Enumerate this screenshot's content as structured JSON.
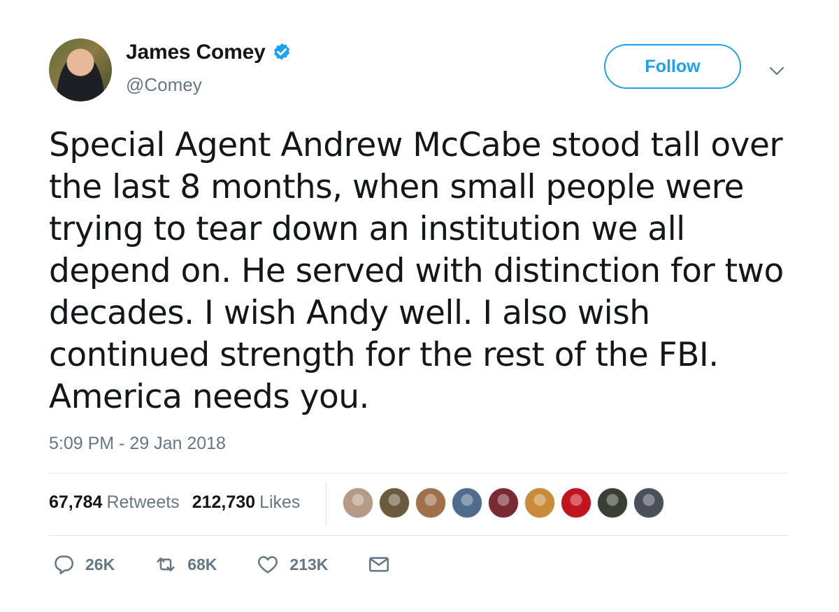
{
  "user": {
    "name": "James Comey",
    "handle": "@Comey"
  },
  "follow_label": "Follow",
  "tweet": {
    "lines": [
      "Special Agent Andrew McCabe stood tall over",
      "the last 8 months, when small people were",
      "trying to tear down an institution we all",
      "depend on. He served with distinction for two",
      "decades. I wish Andy well. I also wish",
      "continued strength for the rest of the FBI.",
      "America needs you."
    ]
  },
  "timestamp": "5:09 PM - 29 Jan 2018",
  "stats": {
    "retweets_count": "67,784",
    "retweets_label": "Retweets",
    "likes_count": "212,730",
    "likes_label": "Likes"
  },
  "likers": [
    {
      "icon": "liker-avatar",
      "color": "#b79a86"
    },
    {
      "icon": "liker-avatar",
      "color": "#6b5a3e"
    },
    {
      "icon": "liker-avatar",
      "color": "#a0704a"
    },
    {
      "icon": "liker-avatar",
      "color": "#4f6c8c"
    },
    {
      "icon": "liker-avatar",
      "color": "#7a2a33"
    },
    {
      "icon": "liker-avatar",
      "color": "#c98a3a"
    },
    {
      "icon": "liker-avatar",
      "color": "#c0141e"
    },
    {
      "icon": "liker-avatar",
      "color": "#3a3f33"
    },
    {
      "icon": "liker-avatar",
      "color": "#4a4f5a"
    }
  ],
  "actions": {
    "reply_count": "26K",
    "retweet_count": "68K",
    "like_count": "213K"
  },
  "colors": {
    "accent": "#1da1f2",
    "secondary_text": "#657786",
    "divider": "#e1e8ed"
  }
}
